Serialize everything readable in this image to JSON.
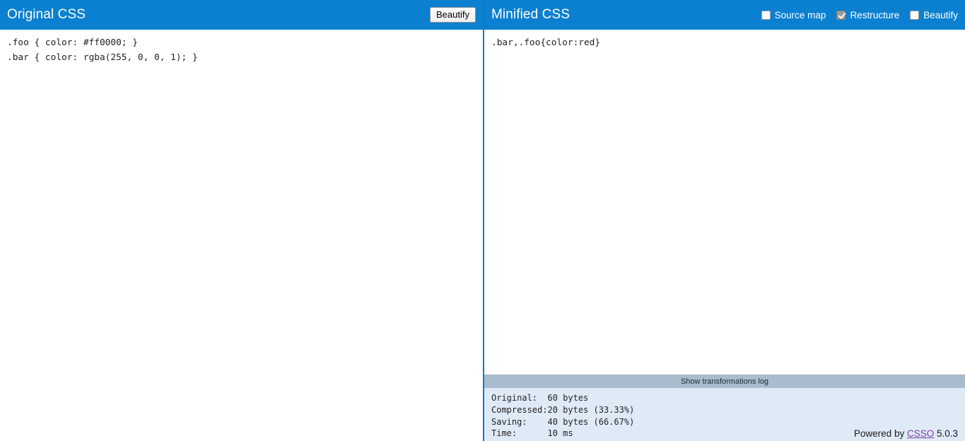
{
  "left_panel": {
    "title": "Original CSS",
    "beautify_button": "Beautify",
    "code": ".foo { color: #ff0000; }\n.bar { color: rgba(255, 0, 0, 1); }"
  },
  "right_panel": {
    "title": "Minified CSS",
    "code": ".bar,.foo{color:red}",
    "options": [
      {
        "label": "Source map",
        "checked": false
      },
      {
        "label": "Restructure",
        "checked": true
      },
      {
        "label": "Beautify",
        "checked": false
      }
    ],
    "log_toggle": "Show transformations log",
    "stats": [
      {
        "label": "Original:",
        "value": "60 bytes"
      },
      {
        "label": "Compressed:",
        "value": "20 bytes (33.33%)"
      },
      {
        "label": "Saving:",
        "value": "40 bytes (66.67%)"
      },
      {
        "label": "Time:",
        "value": "10 ms"
      }
    ],
    "footer": {
      "prefix": "Powered by ",
      "link": "CSSO",
      "suffix": " 5.0.3"
    }
  },
  "colors": {
    "header_blue": "#0b80d0",
    "divider_blue": "#1279bf",
    "log_bar": "#a9bccd",
    "stats_bg": "#dfeaf7",
    "link_purple": "#7b3fa0"
  }
}
